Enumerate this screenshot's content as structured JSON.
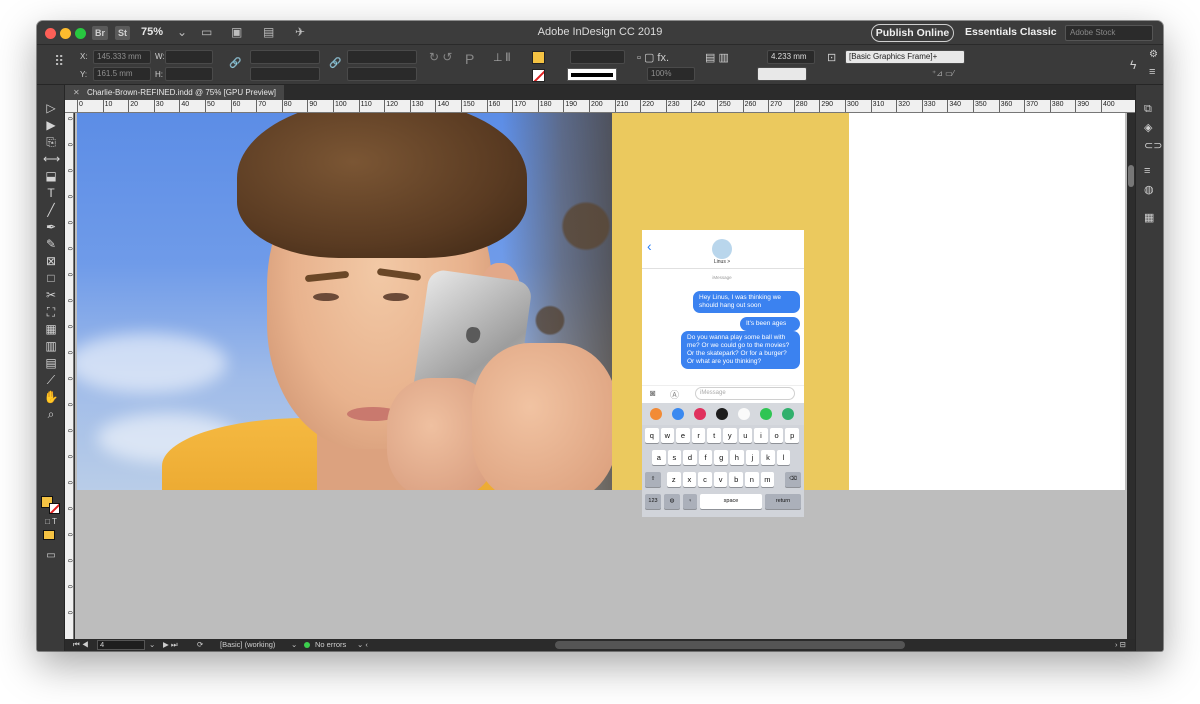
{
  "titlebar": {
    "bridge_badge": "Br",
    "stock_badge": "St",
    "zoom": "75%",
    "app_title": "Adobe InDesign CC 2019",
    "publish_label": "Publish Online",
    "workspace_label": "Essentials Classic",
    "stock_search_placeholder": "Adobe Stock"
  },
  "control": {
    "x_label": "X:",
    "x_value": "145.333 mm",
    "y_label": "Y:",
    "y_value": "161.5 mm",
    "w_label": "W:",
    "h_label": "H:",
    "zoom_pct": "100%",
    "stroke_weight": "4.233 mm",
    "object_style": "[Basic Graphics Frame]+"
  },
  "document": {
    "tab_title": "Charlie-Brown-REFINED.indd @ 75% [GPU Preview]"
  },
  "ruler": {
    "h_labels": [
      "0",
      "10",
      "20",
      "30",
      "40",
      "50",
      "60",
      "70",
      "80",
      "90",
      "100",
      "110",
      "120",
      "130",
      "140",
      "150",
      "160",
      "170",
      "180",
      "190",
      "200",
      "210",
      "220",
      "230",
      "240",
      "250",
      "260",
      "270",
      "280",
      "290",
      "300",
      "310",
      "320",
      "330",
      "340",
      "350",
      "360",
      "370",
      "380",
      "390",
      "400"
    ],
    "v_labels": [
      "0",
      "0",
      "0",
      "0",
      "0",
      "0",
      "0",
      "0",
      "0",
      "0",
      "0",
      "0",
      "0",
      "0",
      "0",
      "0",
      "0",
      "0",
      "0",
      "0"
    ]
  },
  "phone_mock": {
    "contact_name": "Linus >",
    "service_label": "iMessage",
    "messages": [
      "Hey Linus, I was thinking we should hang out soon",
      "It's been ages",
      "Do you wanna play some ball with me? Or we could go to the movies? Or the skatepark? Or for a burger? Or what are you thinking?"
    ],
    "input_placeholder": "iMessage",
    "keyboard_row1": [
      "q",
      "w",
      "e",
      "r",
      "t",
      "y",
      "u",
      "i",
      "o",
      "p"
    ],
    "keyboard_row2": [
      "a",
      "s",
      "d",
      "f",
      "g",
      "h",
      "j",
      "k",
      "l"
    ],
    "keyboard_row3": [
      "z",
      "x",
      "c",
      "v",
      "b",
      "n",
      "m"
    ],
    "key_123": "123",
    "key_space": "space",
    "key_return": "return"
  },
  "status": {
    "page_number": "4",
    "preflight_profile": "[Basic] (working)",
    "errors": "No errors"
  },
  "colors": {
    "fill_swatch": "#f5c343",
    "spread_yellow": "#ebc95e",
    "imessage_blue": "#3b82f0"
  }
}
